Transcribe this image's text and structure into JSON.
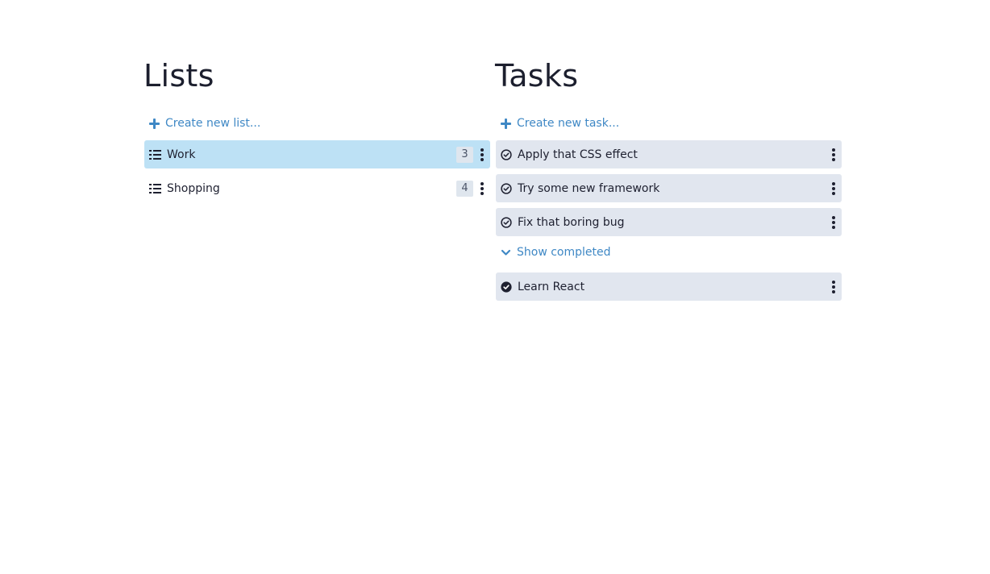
{
  "lists": {
    "title": "Lists",
    "create_label": "Create new list...",
    "items": [
      {
        "label": "Work",
        "count": "3"
      },
      {
        "label": "Shopping",
        "count": "4"
      }
    ]
  },
  "tasks": {
    "title": "Tasks",
    "create_label": "Create new task...",
    "open_items": [
      {
        "label": "Apply that CSS effect"
      },
      {
        "label": "Try some new framework"
      },
      {
        "label": "Fix that boring bug"
      }
    ],
    "show_completed_label": "Show completed",
    "completed_items": [
      {
        "label": "Learn React"
      }
    ]
  },
  "colors": {
    "accent": "#3f88c5",
    "selected_row": "#bde1f5",
    "task_row": "#e1e6ef"
  },
  "icons": {
    "add": "plus-icon",
    "list": "list-icon",
    "menu": "more-vertical-icon",
    "task_open": "circle-check-outline-icon",
    "task_done": "circle-check-filled-icon",
    "expand": "chevron-down-icon"
  }
}
